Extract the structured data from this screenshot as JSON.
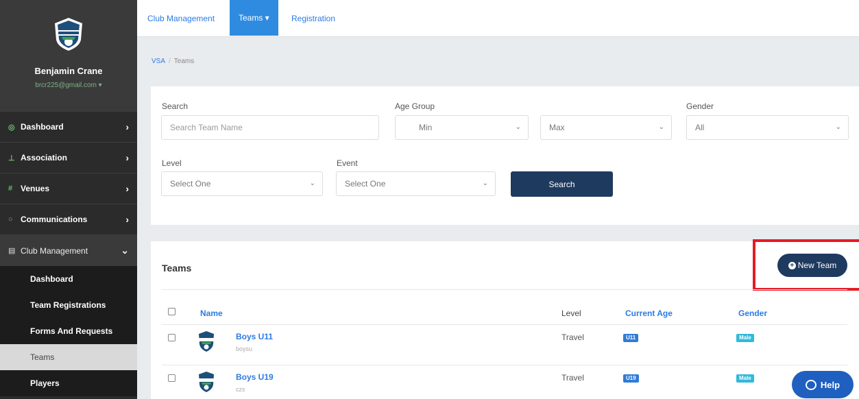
{
  "user": {
    "name": "Benjamin Crane",
    "email": "brcr225@gmail.com ▾"
  },
  "sidebar": {
    "items": [
      {
        "label": "Dashboard",
        "icon": "dashboard-icon"
      },
      {
        "label": "Association",
        "icon": "org-chart-icon"
      },
      {
        "label": "Venues",
        "icon": "venue-icon"
      },
      {
        "label": "Communications",
        "icon": "chat-icon"
      }
    ],
    "open_item": {
      "label": "Club Management",
      "icon": "clipboard-icon"
    },
    "sub_items": [
      "Dashboard",
      "Team Registrations",
      "Forms And Requests",
      "Teams",
      "Players"
    ],
    "active_sub": "Teams"
  },
  "top_tabs": [
    "Club Management",
    "Teams ▾",
    "Registration"
  ],
  "breadcrumb": {
    "root": "VSA",
    "sep": "/",
    "current": "Teams"
  },
  "filters": {
    "search_label": "Search",
    "search_placeholder": "Search Team Name",
    "age_group_label": "Age Group",
    "min_value": "Min",
    "max_value": "Max",
    "gender_label": "Gender",
    "gender_value": "All",
    "level_label": "Level",
    "level_value": "Select One",
    "event_label": "Event",
    "event_value": "Select One",
    "search_button": "Search"
  },
  "teams": {
    "title": "Teams",
    "new_team_button": "New Team",
    "columns": [
      "Name",
      "Level",
      "Current Age",
      "Gender"
    ],
    "rows": [
      {
        "name": "Boys U11",
        "sub": "boysu",
        "level": "Travel",
        "age": "U11",
        "gender": "Male"
      },
      {
        "name": "Boys U19",
        "sub": "czs",
        "level": "Travel",
        "age": "U19",
        "gender": "Male"
      }
    ]
  },
  "help_button": "Help",
  "colors": {
    "accent": "#2f8be0",
    "navy": "#1f3a5f",
    "highlight": "#e51a24"
  }
}
